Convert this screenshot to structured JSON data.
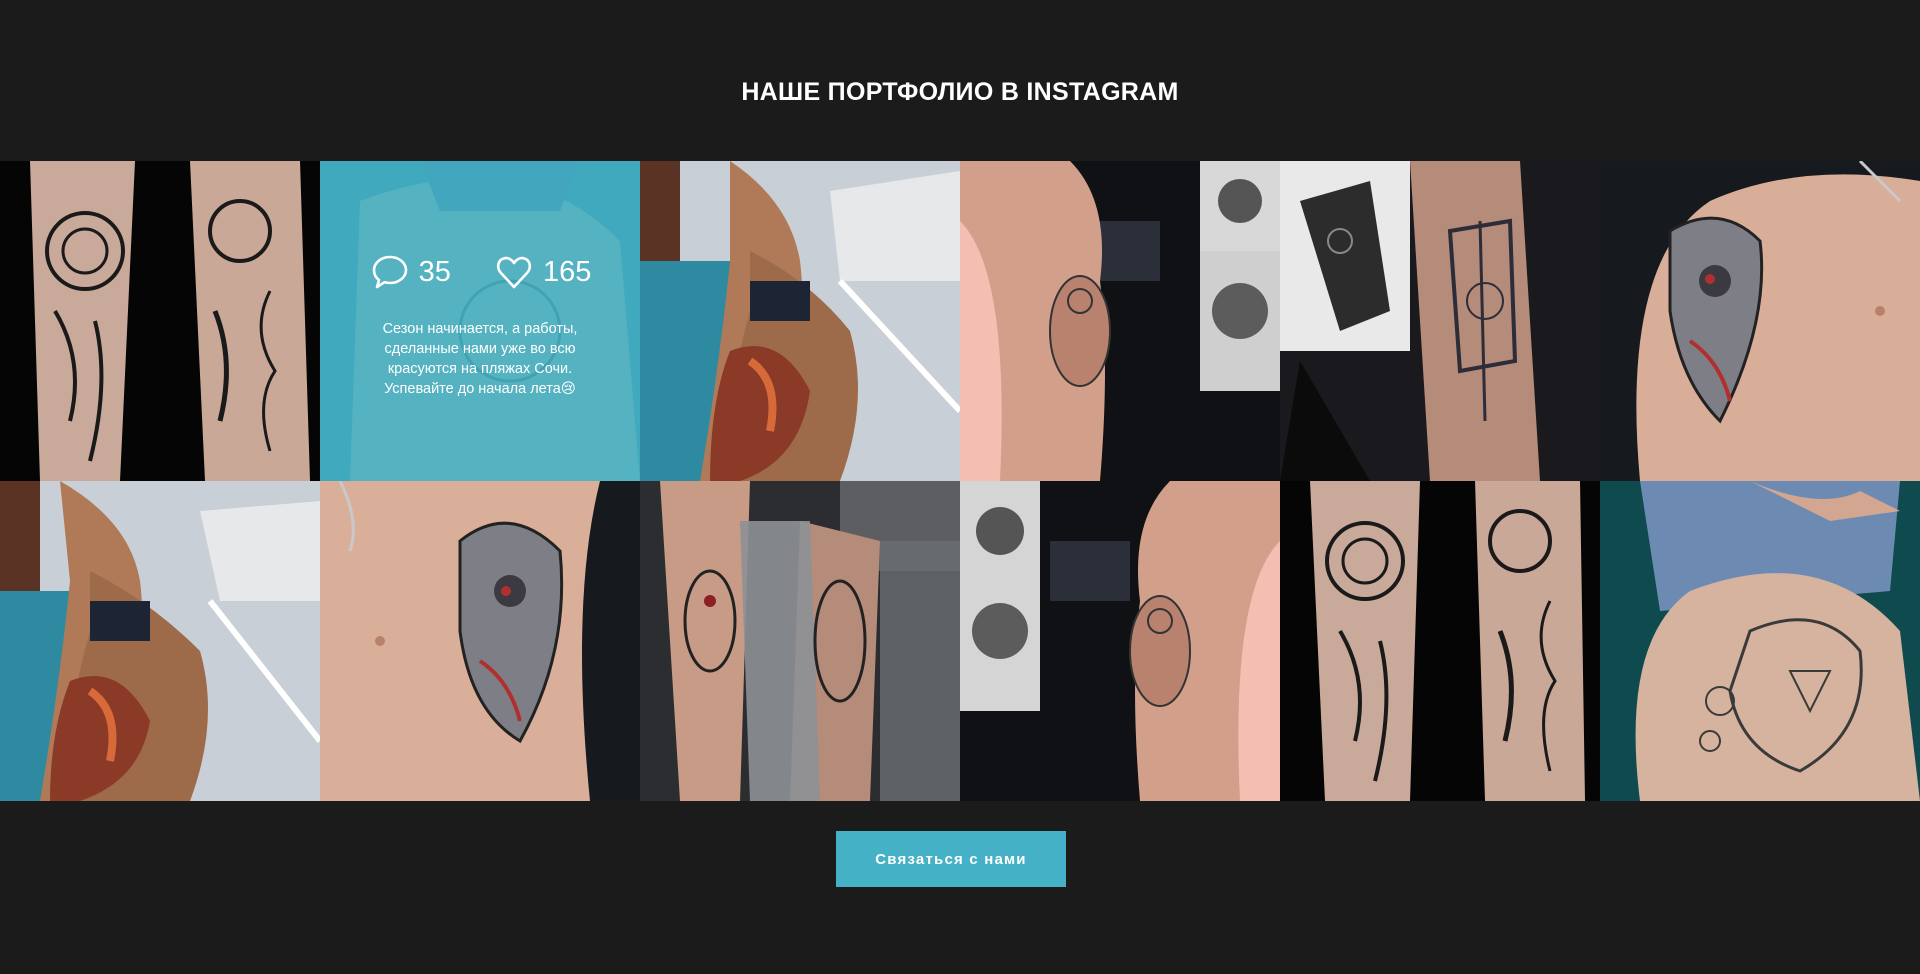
{
  "section": {
    "title": "НАШЕ ПОРТФОЛИО В INSTAGRAM"
  },
  "posts": [
    {
      "subject": "forearm-floral-portrait-tattoo"
    },
    {
      "subject": "thigh-lion-floral-tattoo",
      "hovered": true,
      "comments_count": "35",
      "likes_count": "165",
      "caption": "Сезон начинается, а работы, сделанные нами уже во всю красуются на пляжах Сочи. Успевайте до начала лета😢",
      "icons": {
        "comments": "speech-bubble-icon",
        "likes": "heart-icon"
      }
    },
    {
      "subject": "thigh-color-tattoo-woman-on-stairs"
    },
    {
      "subject": "shoulder-marilyn-monroe-tattoo"
    },
    {
      "subject": "forearm-axe-ornament-tattoo"
    },
    {
      "subject": "shoulder-biomech-skull-tattoo"
    },
    {
      "subject": "thigh-color-tattoo-woman-on-stairs"
    },
    {
      "subject": "shoulder-biomech-skull-tattoo"
    },
    {
      "subject": "arm-joker-tattoo-wrapped"
    },
    {
      "subject": "shoulder-marilyn-monroe-tattoo"
    },
    {
      "subject": "forearm-floral-portrait-tattoo"
    },
    {
      "subject": "thigh-lion-floral-tattoo"
    }
  ],
  "cta": {
    "label": "Связаться с нами"
  },
  "colors": {
    "background": "#1b1b1b",
    "accent": "#45b1c7",
    "overlay": "#43b2c6",
    "text": "#ffffff"
  }
}
